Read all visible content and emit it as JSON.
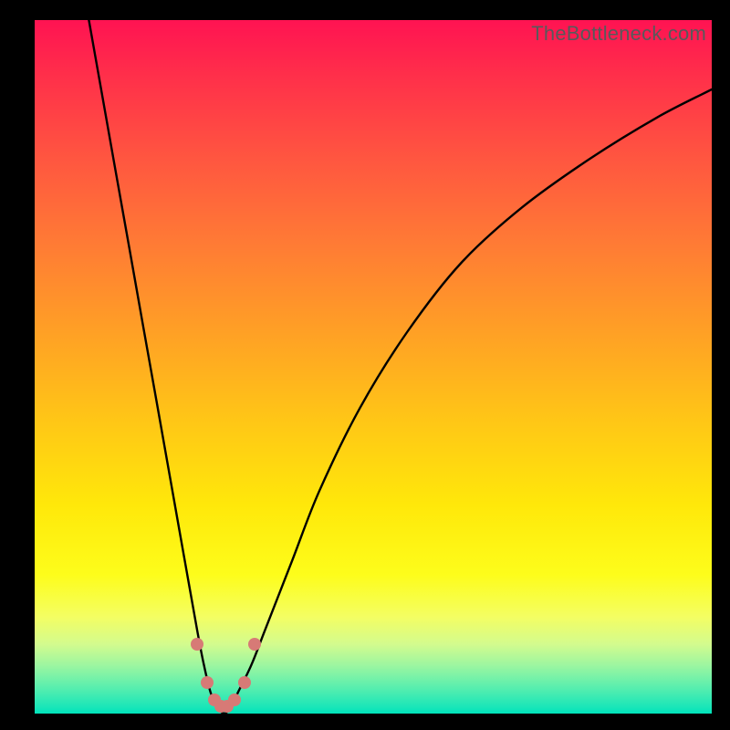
{
  "watermark": "TheBottleneck.com",
  "chart_data": {
    "type": "line",
    "title": "",
    "xlabel": "",
    "ylabel": "",
    "xlim": [
      0,
      100
    ],
    "ylim": [
      0,
      100
    ],
    "grid": false,
    "legend": false,
    "series": [
      {
        "name": "bottleneck-curve",
        "x": [
          8,
          10,
          12,
          14,
          16,
          18,
          20,
          22,
          24,
          25,
          26,
          27,
          28,
          29,
          30,
          32,
          34,
          38,
          42,
          48,
          55,
          63,
          72,
          82,
          92,
          100
        ],
        "values": [
          100,
          89,
          78,
          67,
          56,
          45,
          34,
          23,
          12,
          7,
          3,
          1,
          0,
          1,
          3,
          7,
          12,
          22,
          32,
          44,
          55,
          65,
          73,
          80,
          86,
          90
        ]
      }
    ],
    "markers": {
      "name": "highlight-points",
      "x": [
        24.0,
        25.5,
        26.5,
        27.5,
        28.5,
        29.5,
        31.0,
        32.5
      ],
      "values": [
        10.0,
        4.5,
        2.0,
        1.0,
        1.0,
        2.0,
        4.5,
        10.0
      ]
    },
    "colors": {
      "curve": "#000000",
      "marker": "#d77a76",
      "gradient_top": "#ff1352",
      "gradient_bottom": "#00e3bb"
    }
  }
}
